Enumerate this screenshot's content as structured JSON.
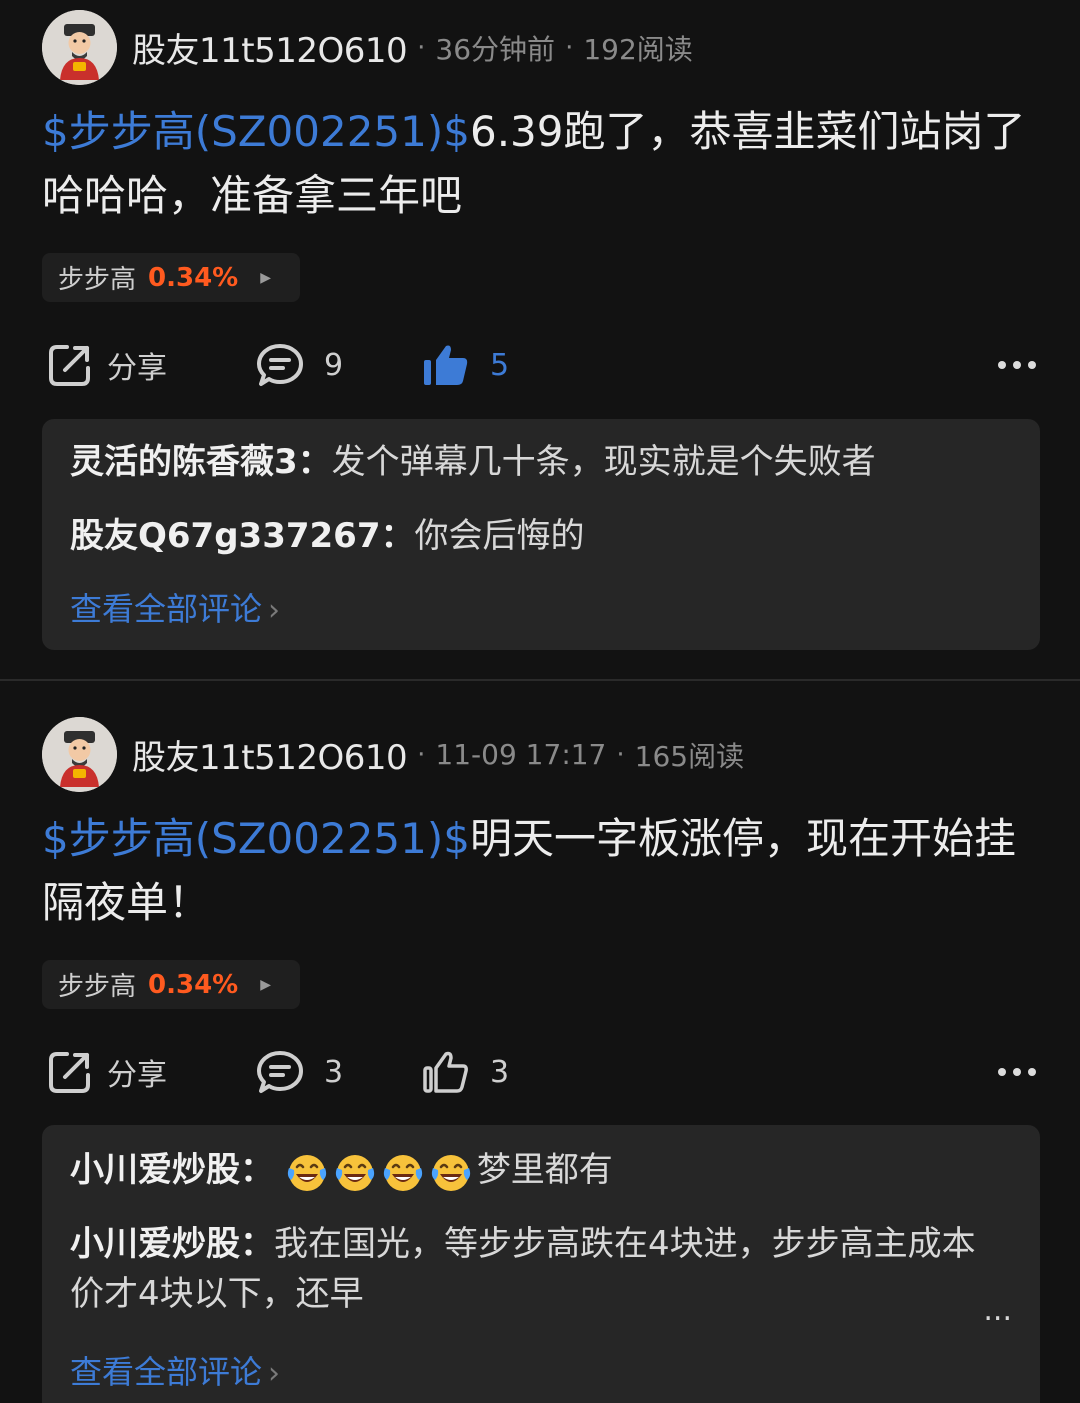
{
  "posts": [
    {
      "author": "股友11t512O610",
      "time": "36分钟前",
      "reads": "192阅读",
      "ticker": "$步步高(SZ002251)$",
      "text": "6.39跑了，恭喜韭菜们站岗了哈哈哈，准备拿三年吧",
      "stock": {
        "name": "步步高",
        "change": "0.34%"
      },
      "actions": {
        "share_label": "分享",
        "comments": "9",
        "likes": "5",
        "liked": true
      },
      "comments": [
        {
          "user": "灵活的陈香薇3",
          "text": "发个弹幕几十条，现实就是个失败者"
        },
        {
          "user": "股友Q67g337267",
          "text": "你会后悔的"
        }
      ],
      "view_all": "查看全部评论"
    },
    {
      "author": "股友11t512O610",
      "time": "11-09 17:17",
      "reads": "165阅读",
      "ticker": "$步步高(SZ002251)$",
      "text": "明天一字板涨停，现在开始挂隔夜单！",
      "stock": {
        "name": "步步高",
        "change": "0.34%"
      },
      "actions": {
        "share_label": "分享",
        "comments": "3",
        "likes": "3",
        "liked": false
      },
      "comments": [
        {
          "user": "小川爱炒股",
          "text": "梦里都有",
          "emoji_count": 4
        },
        {
          "user": "小川爱炒股",
          "text": "我在国光，等步步高跌在4块进，步步高主成本价才4块以下，还早"
        }
      ],
      "truncated_marker": "...",
      "view_all": "查看全部评论"
    }
  ],
  "icons": {
    "share": "share-icon",
    "comment": "comment-icon",
    "like": "thumbs-up-icon",
    "more": "more-icon",
    "emoji": "laughing-crying-emoji"
  },
  "colors": {
    "background": "#121212",
    "link_blue": "#3d7bd6",
    "rise_orange": "#ff5a1f",
    "card": "#262626"
  }
}
